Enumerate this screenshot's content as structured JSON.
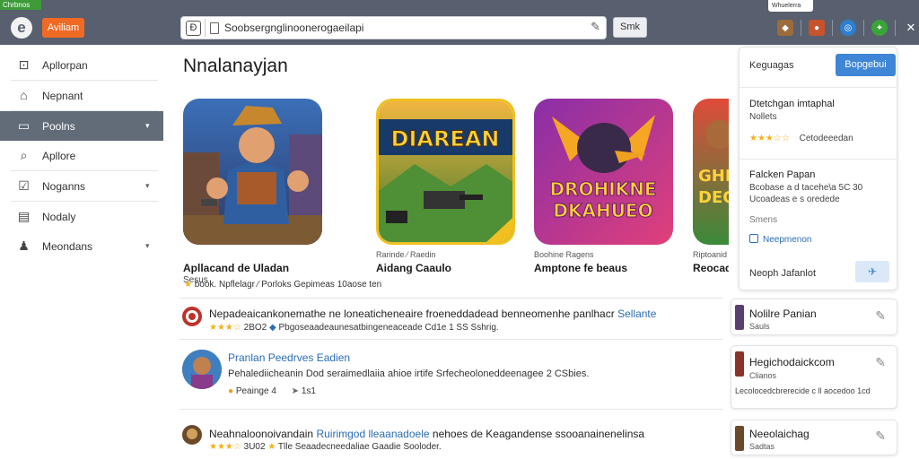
{
  "topbar": {
    "tag": "Chrbnos",
    "brand_button": "Aviliam",
    "search_value": "Soobsergnglinoonerogaeilapi",
    "search_button": "Smk",
    "notification": "Whuelerra"
  },
  "sidebar": {
    "items": [
      {
        "label": "Apllorpan",
        "icon": "app-icon"
      },
      {
        "label": "Nepnant",
        "icon": "home-icon"
      },
      {
        "label": "Poolns",
        "icon": "folder-icon"
      },
      {
        "label": "Apllore",
        "icon": "search-icon"
      },
      {
        "label": "Noganns",
        "icon": "edit-icon"
      },
      {
        "label": "Nodaly",
        "icon": "chart-icon"
      },
      {
        "label": "Meondans",
        "icon": "person-icon"
      }
    ]
  },
  "main": {
    "title": "Nnalanayjan",
    "cards": [
      {
        "sub": "",
        "title": "Apllacand de Uladan",
        "dev": "Sesus",
        "art_text": ""
      },
      {
        "sub": "Rarinde ⁄ Raedin",
        "title": "Aidang Caaulo",
        "dev": "",
        "art_text": "DIAREAN"
      },
      {
        "sub": "Boohine Ragens",
        "title": "Amptone fe beaus",
        "dev": "",
        "art_text_1": "DROHIKNE",
        "art_text_2": "DKAHUEO"
      },
      {
        "sub": "Riptoanid",
        "title": "Reocadas",
        "dev": "",
        "art_text_1": "GHI",
        "art_text_2": "DEO"
      }
    ],
    "meta": "book. Npflelagr ⁄ Porloks Gepimeas 10aose ten",
    "rows": [
      {
        "line1_a": "Nepadeaicankonemathe",
        "line1_b": "ne loneaticheneaire froeneddadead benneomenhe panlhacr",
        "line1_hl": "Sellante",
        "rating": "★★★☆",
        "count": "2BO2",
        "line2": "Pbgoseaadeaunesatbingeneaceade Cd1e 1 SS Sshrig."
      },
      {
        "line1_hl": "Pranlan Peedrves Eadien",
        "line2": "Pehalediicheanin Dod seraimedlaiia ahioe irtife Srfecheoloneddeenagee 2 CSbies.",
        "tag1": "Peainge",
        "tag1_num": "4",
        "tag2": "1s1"
      },
      {
        "line1_a": "Neahnaloonoivandain",
        "line1_hl": "Ruirimgod lleaanadoele",
        "line1_b": "nehoes de Keagandense ssooanainenelinsa",
        "rating": "★★★☆",
        "count": "3U02",
        "line2": "Tlle Seaadecneedaliae Gaadie Sooloder."
      }
    ]
  },
  "rpanel": {
    "header": "Keguagas",
    "button": "Bopgebui",
    "item1_title": "Dtetchgan imtaphal",
    "item1_sub": "Nollets",
    "item1_rating": "★★★☆☆",
    "item1_meta": "Cetodeeedan",
    "item2_title": "Falcken Papan",
    "item2_line1": "Bcobase a d tacehe\\a 5C 30",
    "item2_line2": "Ucoadeas e s oredede",
    "item2_label": "Smens",
    "item2_link": "Neepmenon",
    "footer": "Neoph Jafanlot"
  },
  "scards": [
    {
      "title": "Nolilre Panian",
      "sub": "Sauls",
      "extra": "",
      "thumb": "#5a4070"
    },
    {
      "title": "Hegichodaickcom",
      "sub": "Clianos",
      "extra": "Lecolocedcbrerecide c ll aocedoo 1cd",
      "thumb": "#8a3328"
    },
    {
      "title": "Neeolaichag",
      "sub": "Sadtas",
      "extra": "",
      "thumb": "#6b4a2a"
    }
  ],
  "colors": {
    "topbar": "#585f6e",
    "accent_blue": "#3f86d6",
    "brand_orange": "#ef6a25",
    "sidebar_active": "#626b78",
    "star": "#f2b11b"
  }
}
